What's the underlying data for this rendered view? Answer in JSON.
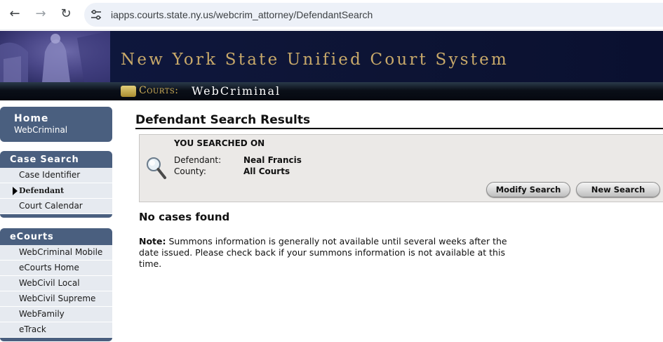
{
  "browser": {
    "url": "iapps.courts.state.ny.us/webcrim_attorney/DefendantSearch"
  },
  "banner": {
    "title": "New York State Unified Court System",
    "courts_label": "Courts:",
    "app_label": "WebCriminal"
  },
  "sidebar": {
    "home": {
      "title": "Home",
      "subtitle": "WebCriminal"
    },
    "case_search": {
      "heading": "Case Search",
      "items": [
        {
          "label": "Case Identifier"
        },
        {
          "label": "Defendant",
          "active": true
        },
        {
          "label": "Court Calendar"
        }
      ]
    },
    "ecourts": {
      "heading": "eCourts",
      "items": [
        {
          "label": "WebCriminal Mobile"
        },
        {
          "label": "eCourts Home"
        },
        {
          "label": "WebCivil Local"
        },
        {
          "label": "WebCivil Supreme"
        },
        {
          "label": "WebFamily"
        },
        {
          "label": "eTrack"
        }
      ]
    }
  },
  "main": {
    "title": "Defendant Search Results",
    "search_summary": {
      "heading": "YOU SEARCHED ON",
      "defendant_label": "Defendant:",
      "defendant_value": "Neal Francis",
      "county_label": "County:",
      "county_value": "All Courts"
    },
    "buttons": {
      "modify": "Modify Search",
      "new": "New Search"
    },
    "result_text": "No cases found",
    "note_label": "Note:",
    "note_text": " Summons information is generally not available until several weeks after the date issued. Please check back if your summons information is not available at this time."
  }
}
